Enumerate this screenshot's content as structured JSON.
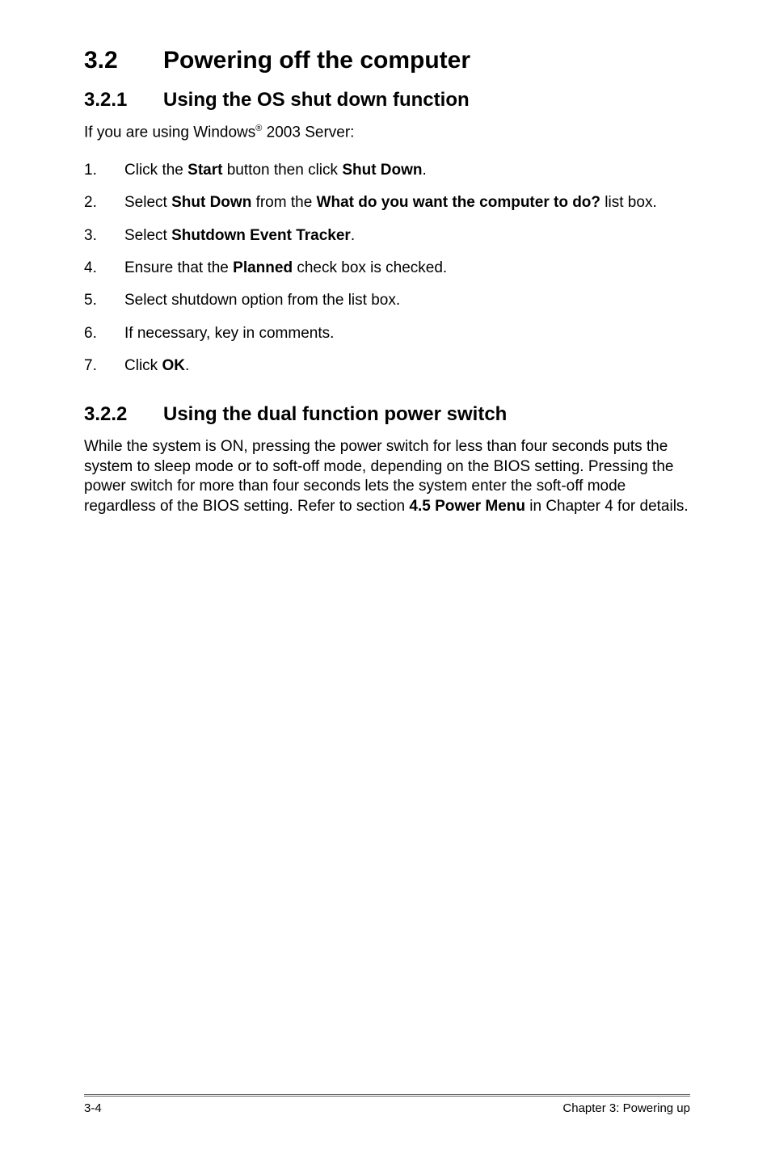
{
  "section": {
    "number": "3.2",
    "title": "Powering off the computer"
  },
  "sub1": {
    "number": "3.2.1",
    "title": "Using the OS shut down function",
    "intro_prefix": "If you are using Windows",
    "intro_sup": "®",
    "intro_suffix": " 2003 Server:",
    "steps": [
      {
        "marker": "1.",
        "parts": [
          {
            "t": "Click the "
          },
          {
            "t": "Start",
            "b": true
          },
          {
            "t": " button then click "
          },
          {
            "t": "Shut Down",
            "b": true
          },
          {
            "t": "."
          }
        ]
      },
      {
        "marker": "2.",
        "parts": [
          {
            "t": "Select "
          },
          {
            "t": "Shut Down",
            "b": true
          },
          {
            "t": " from the "
          },
          {
            "t": "What do you want the computer to do?",
            "b": true
          },
          {
            "t": " list box."
          }
        ]
      },
      {
        "marker": "3.",
        "parts": [
          {
            "t": "Select "
          },
          {
            "t": "Shutdown Event Tracker",
            "b": true
          },
          {
            "t": "."
          }
        ]
      },
      {
        "marker": "4.",
        "parts": [
          {
            "t": "Ensure that the "
          },
          {
            "t": "Planned",
            "b": true
          },
          {
            "t": " check box is checked."
          }
        ]
      },
      {
        "marker": "5.",
        "parts": [
          {
            "t": "Select shutdown option from the list box."
          }
        ]
      },
      {
        "marker": "6.",
        "parts": [
          {
            "t": "If necessary, key in comments."
          }
        ]
      },
      {
        "marker": "7.",
        "parts": [
          {
            "t": "Click "
          },
          {
            "t": "OK",
            "b": true
          },
          {
            "t": "."
          }
        ]
      }
    ]
  },
  "sub2": {
    "number": "3.2.2",
    "title": "Using the dual function power switch",
    "body_parts": [
      {
        "t": "While the system is ON, pressing the power switch for less than four seconds puts the system to sleep mode or to soft-off mode, depending on the BIOS setting. Pressing the power switch for more than four seconds lets the system enter the soft-off mode regardless of the BIOS setting. Refer to section "
      },
      {
        "t": "4.5  Power Menu",
        "b": true
      },
      {
        "t": " in Chapter 4 for details."
      }
    ]
  },
  "footer": {
    "left": "3-4",
    "right": "Chapter 3: Powering up"
  }
}
